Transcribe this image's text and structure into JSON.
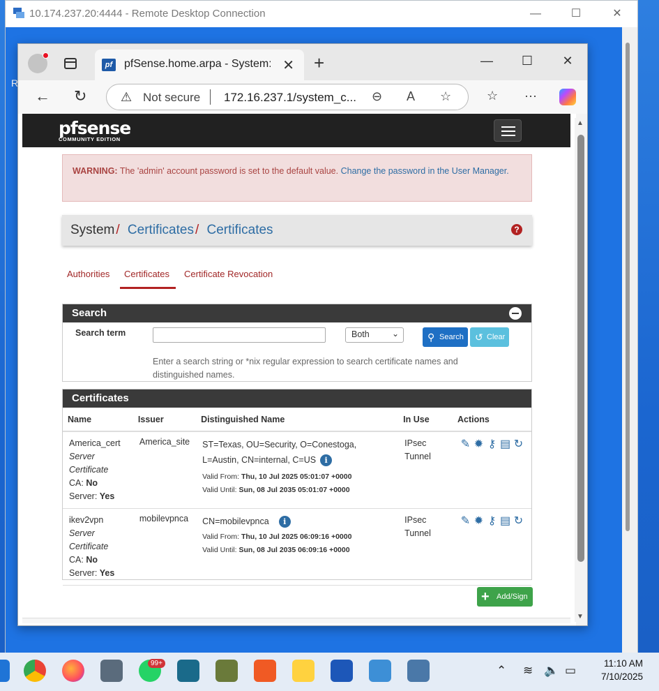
{
  "rdc": {
    "title": "10.174.237.20:4444 - Remote Desktop Connection",
    "partial_letter": "R"
  },
  "browser": {
    "tab_title": "pfSense.home.arpa - System: Cert",
    "favicon_text": "pf",
    "security_label": "Not secure",
    "url": "172.16.237.1/system_c..."
  },
  "pfsense": {
    "logo_main": "pfsense",
    "logo_sub": "COMMUNITY EDITION",
    "alert": {
      "strong": "WARNING:",
      "text": "The 'admin' account password is set to the default value.",
      "link": "Change the password in the User Manager."
    },
    "breadcrumb": {
      "root": "System",
      "level1": "Certificates",
      "level2": "Certificates"
    },
    "tabs": [
      {
        "label": "Authorities"
      },
      {
        "label": "Certificates"
      },
      {
        "label": "Certificate Revocation"
      }
    ],
    "search": {
      "title": "Search",
      "term_label": "Search term",
      "term_value": "",
      "scope_selected": "Both",
      "search_button": "Search",
      "clear_button": "Clear",
      "hint": "Enter a search string or *nix regular expression to search certificate names and distinguished names."
    },
    "certificates": {
      "title": "Certificates",
      "columns": [
        "Name",
        "Issuer",
        "Distinguished Name",
        "In Use",
        "Actions"
      ],
      "rows": [
        {
          "name": "America_cert",
          "type": "Server Certificate",
          "ca_label": "CA:",
          "ca_value": "No",
          "server_label": "Server:",
          "server_value": "Yes",
          "issuer": "America_site",
          "dn": "ST=Texas, OU=Security, O=Conestoga, L=Austin, CN=internal, C=US",
          "valid_from_label": "Valid From:",
          "valid_from": "Thu, 10 Jul 2025 05:01:07 +0000",
          "valid_until_label": "Valid Until:",
          "valid_until": "Sun, 08 Jul 2035 05:01:07 +0000",
          "in_use": "IPsec Tunnel"
        },
        {
          "name": "ikev2vpn",
          "type": "Server Certificate",
          "ca_label": "CA:",
          "ca_value": "No",
          "server_label": "Server:",
          "server_value": "Yes",
          "issuer": "mobilevpnca",
          "dn": "CN=mobilevpnca",
          "valid_from_label": "Valid From:",
          "valid_from": "Thu, 10 Jul 2025 06:09:16 +0000",
          "valid_until_label": "Valid Until:",
          "valid_until": "Sun, 08 Jul 2035 06:09:16 +0000",
          "in_use": "IPsec Tunnel"
        }
      ],
      "add_button": "Add/Sign"
    }
  },
  "taskbar": {
    "whatsapp_badge": "99+",
    "time": "11:10 AM",
    "date": "7/10/2025"
  }
}
